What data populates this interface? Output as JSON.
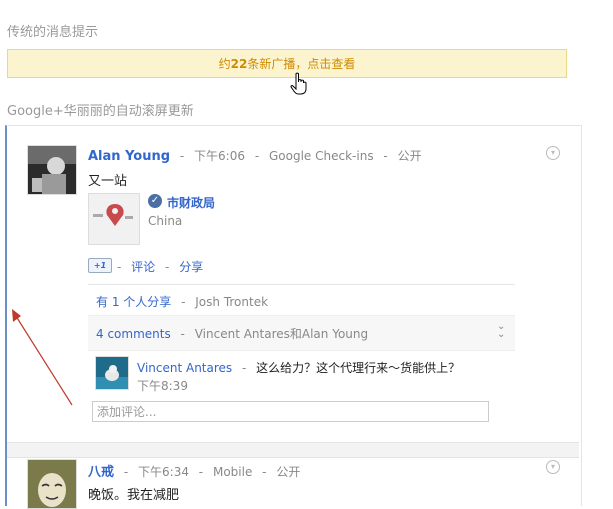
{
  "labels": {
    "traditional": "传统的消息提示",
    "autoscroll": "Google+华丽丽的自动滚屏更新"
  },
  "banner": {
    "prefix": "约",
    "count": "22",
    "suffix": "条新广播，点击查看"
  },
  "post1": {
    "author": "Alan Young",
    "time": "下午6:06",
    "source": "Google Check-ins",
    "visibility": "公开",
    "text": "又一站",
    "place_name": "市财政局",
    "place_country": "China",
    "plus_one": "+1",
    "comment_link": "评论",
    "share_link": "分享",
    "shares_text": "有 1 个人分享",
    "sharer": "Josh Trontek",
    "comments_count": "4 comments",
    "commenters": "Vincent Antares和Alan Young",
    "comment": {
      "author": "Vincent Antares",
      "text": "这么给力？这个代理行来～货能供上？",
      "time": "下午8:39"
    },
    "add_comment_placeholder": "添加评论..."
  },
  "post2": {
    "author": "八戒",
    "time": "下午6:34",
    "source": "Mobile",
    "visibility": "公开",
    "text": "晚饭。我在减肥"
  },
  "sep": "-",
  "colors": {
    "accent": "#3366cc",
    "banner_bg": "#fbf4cf",
    "banner_text": "#d08a00",
    "arrow": "#c0392b"
  }
}
